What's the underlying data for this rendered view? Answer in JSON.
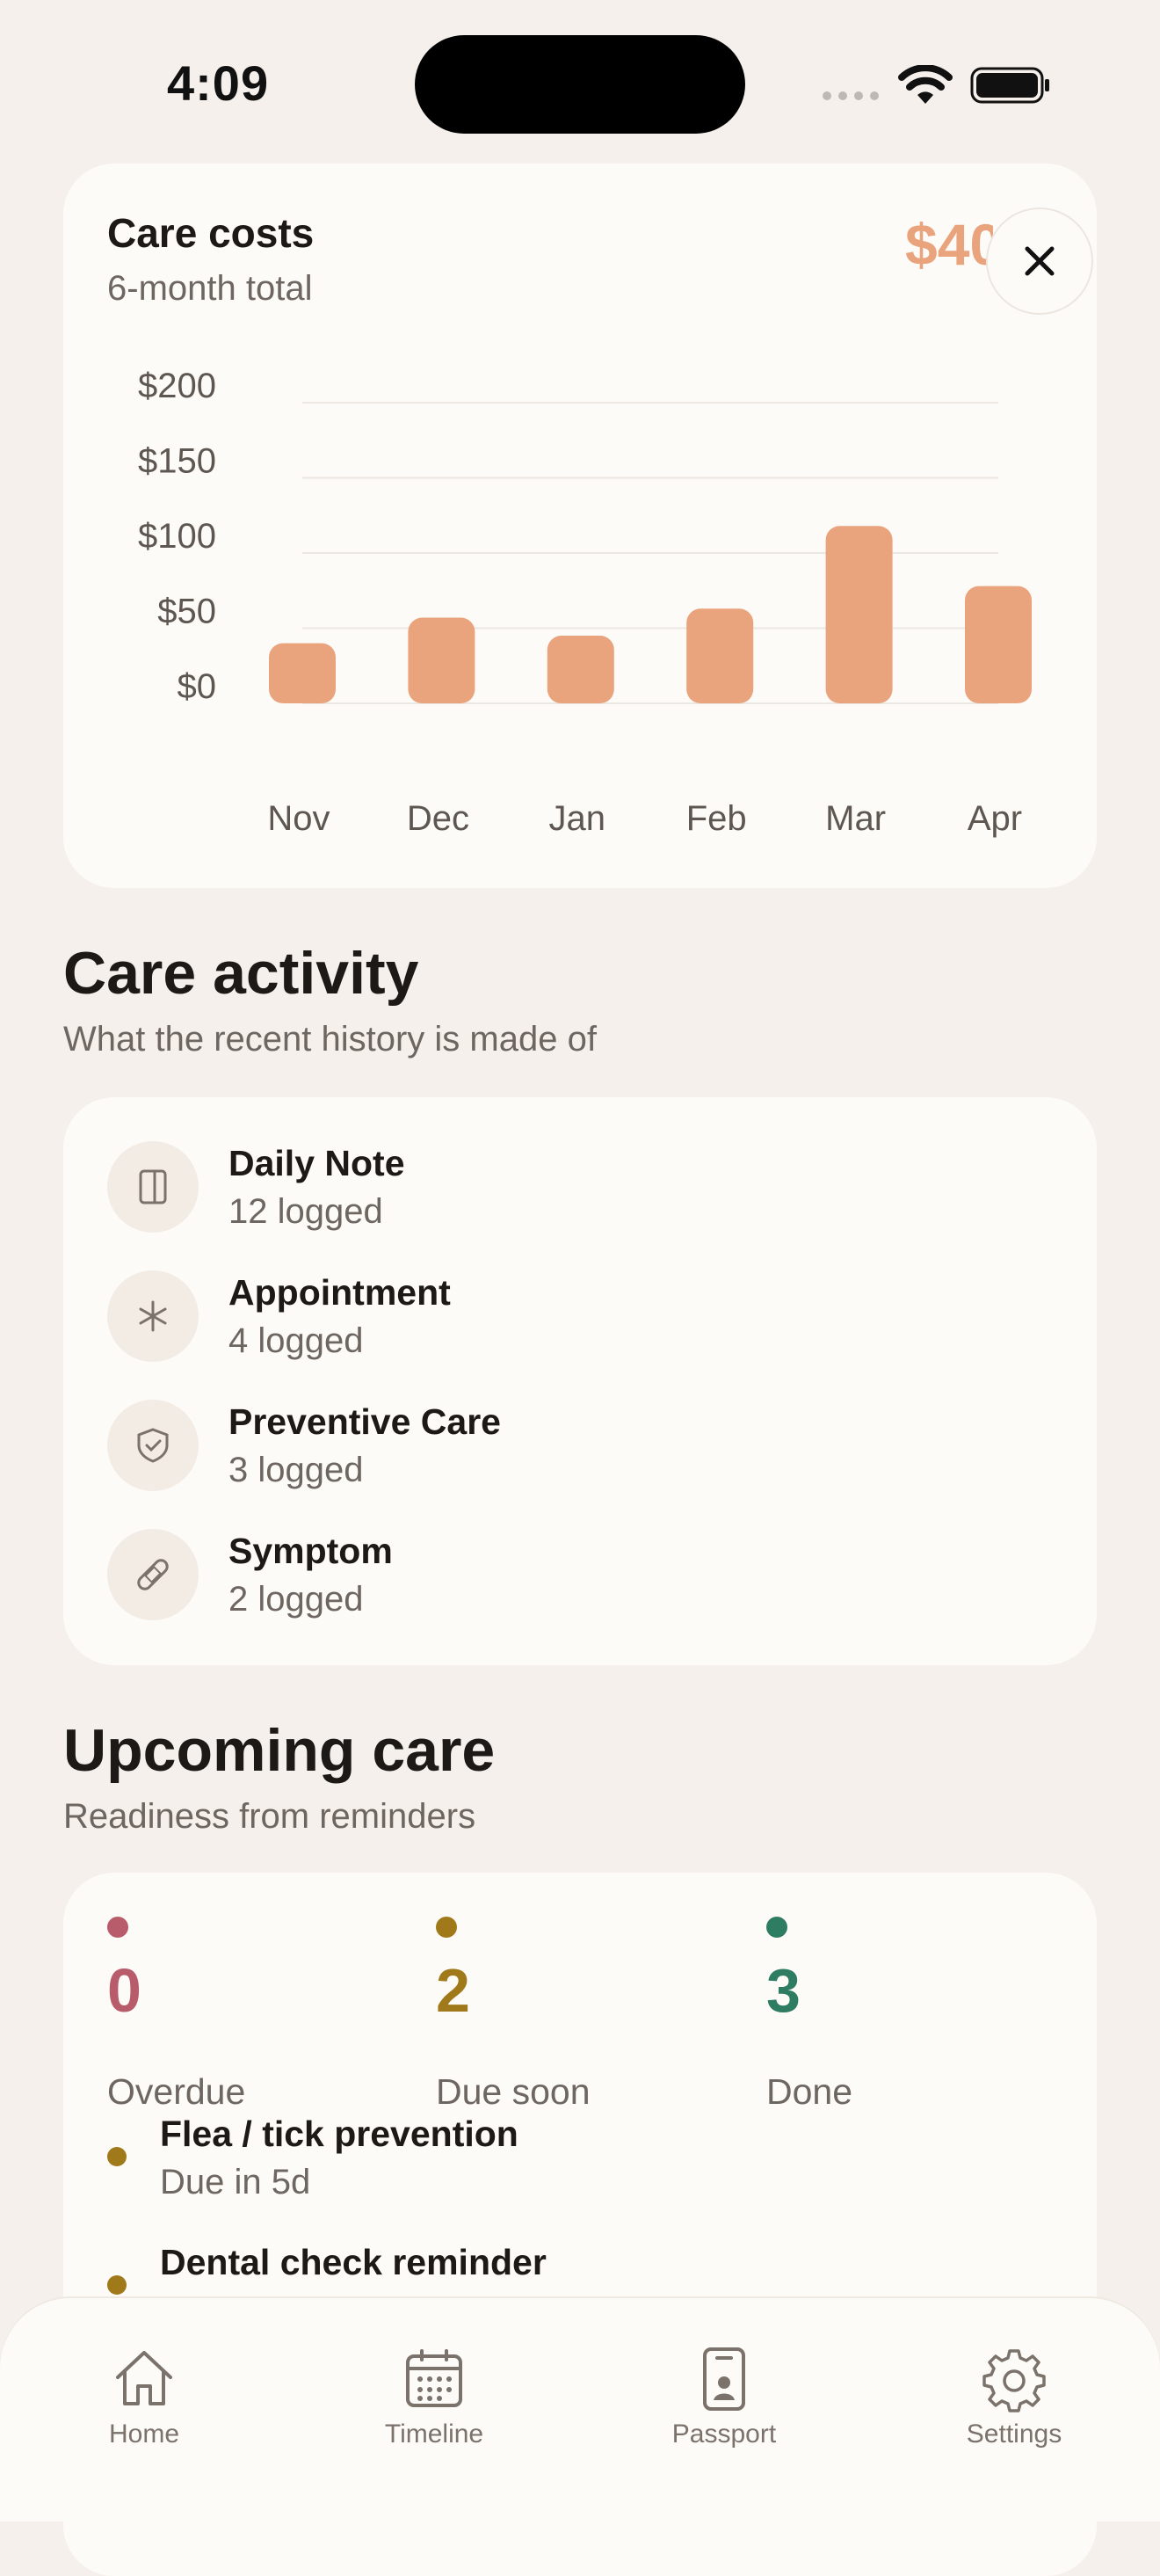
{
  "status_bar": {
    "time": "4:09"
  },
  "cost_card": {
    "title": "Care costs",
    "subtitle": "6-month total",
    "total": "$40",
    "close_icon": "close-icon",
    "bar_color": "#E9A47D"
  },
  "chart_data": {
    "type": "bar",
    "categories": [
      "Nov",
      "Dec",
      "Jan",
      "Feb",
      "Mar",
      "Apr"
    ],
    "values": [
      40,
      57,
      45,
      63,
      118,
      78
    ],
    "yticks": [
      "$200",
      "$150",
      "$100",
      "$50",
      "$0"
    ],
    "ylim": [
      0,
      200
    ],
    "grid": true,
    "title": "",
    "xlabel": "",
    "ylabel": ""
  },
  "activity": {
    "title": "Care activity",
    "subtitle": "What the recent history is made of",
    "items": [
      {
        "label": "Daily Note",
        "count": "12 logged",
        "icon": "note-icon"
      },
      {
        "label": "Appointment",
        "count": "4 logged",
        "icon": "medical-star-icon"
      },
      {
        "label": "Preventive Care",
        "count": "3 logged",
        "icon": "shield-check-icon"
      },
      {
        "label": "Symptom",
        "count": "2 logged",
        "icon": "bandage-icon"
      }
    ]
  },
  "upcoming": {
    "title": "Upcoming care",
    "subtitle": "Readiness from reminders",
    "stats": [
      {
        "value": "0",
        "label": "Overdue",
        "color": "#B85C6B"
      },
      {
        "value": "2",
        "label": "Due soon",
        "color": "#A07A1A"
      },
      {
        "value": "3",
        "label": "Done",
        "color": "#2E7D62"
      }
    ],
    "reminders": [
      {
        "title": "Flea / tick prevention",
        "due": "Due in 5d"
      },
      {
        "title": "Dental check reminder",
        "due": ""
      }
    ]
  },
  "tabbar": {
    "items": [
      {
        "label": "Home",
        "icon": "home-icon"
      },
      {
        "label": "Timeline",
        "icon": "calendar-icon"
      },
      {
        "label": "Passport",
        "icon": "passport-icon"
      },
      {
        "label": "Settings",
        "icon": "gear-icon"
      }
    ]
  }
}
